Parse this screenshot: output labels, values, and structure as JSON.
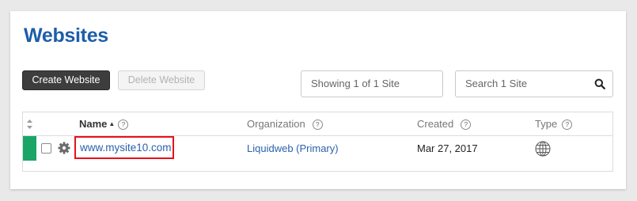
{
  "page": {
    "title": "Websites"
  },
  "toolbar": {
    "create_label": "Create Website",
    "delete_label": "Delete Website"
  },
  "status": {
    "showing": "Showing 1 of 1 Site"
  },
  "search": {
    "placeholder": "Search 1 Site",
    "icon": "search-icon"
  },
  "table": {
    "columns": [
      {
        "label": "Name",
        "help": "?",
        "sorted": "ascending"
      },
      {
        "label": "Organization",
        "help": "?"
      },
      {
        "label": "Created",
        "help": "?"
      },
      {
        "label": "Type",
        "help": "?"
      }
    ],
    "rows": [
      {
        "name": "www.mysite10.com",
        "organization": "Liquidweb (Primary)",
        "created": "Mar 27, 2017",
        "type_icon": "globe-icon",
        "status_color": "#1aa566",
        "highlighted": true
      }
    ]
  },
  "colors": {
    "title": "#1d5ea9",
    "link": "#2a62ad",
    "status_active": "#1aa566",
    "highlight": "#e8101a",
    "primary_button": "#3d3d3d"
  }
}
